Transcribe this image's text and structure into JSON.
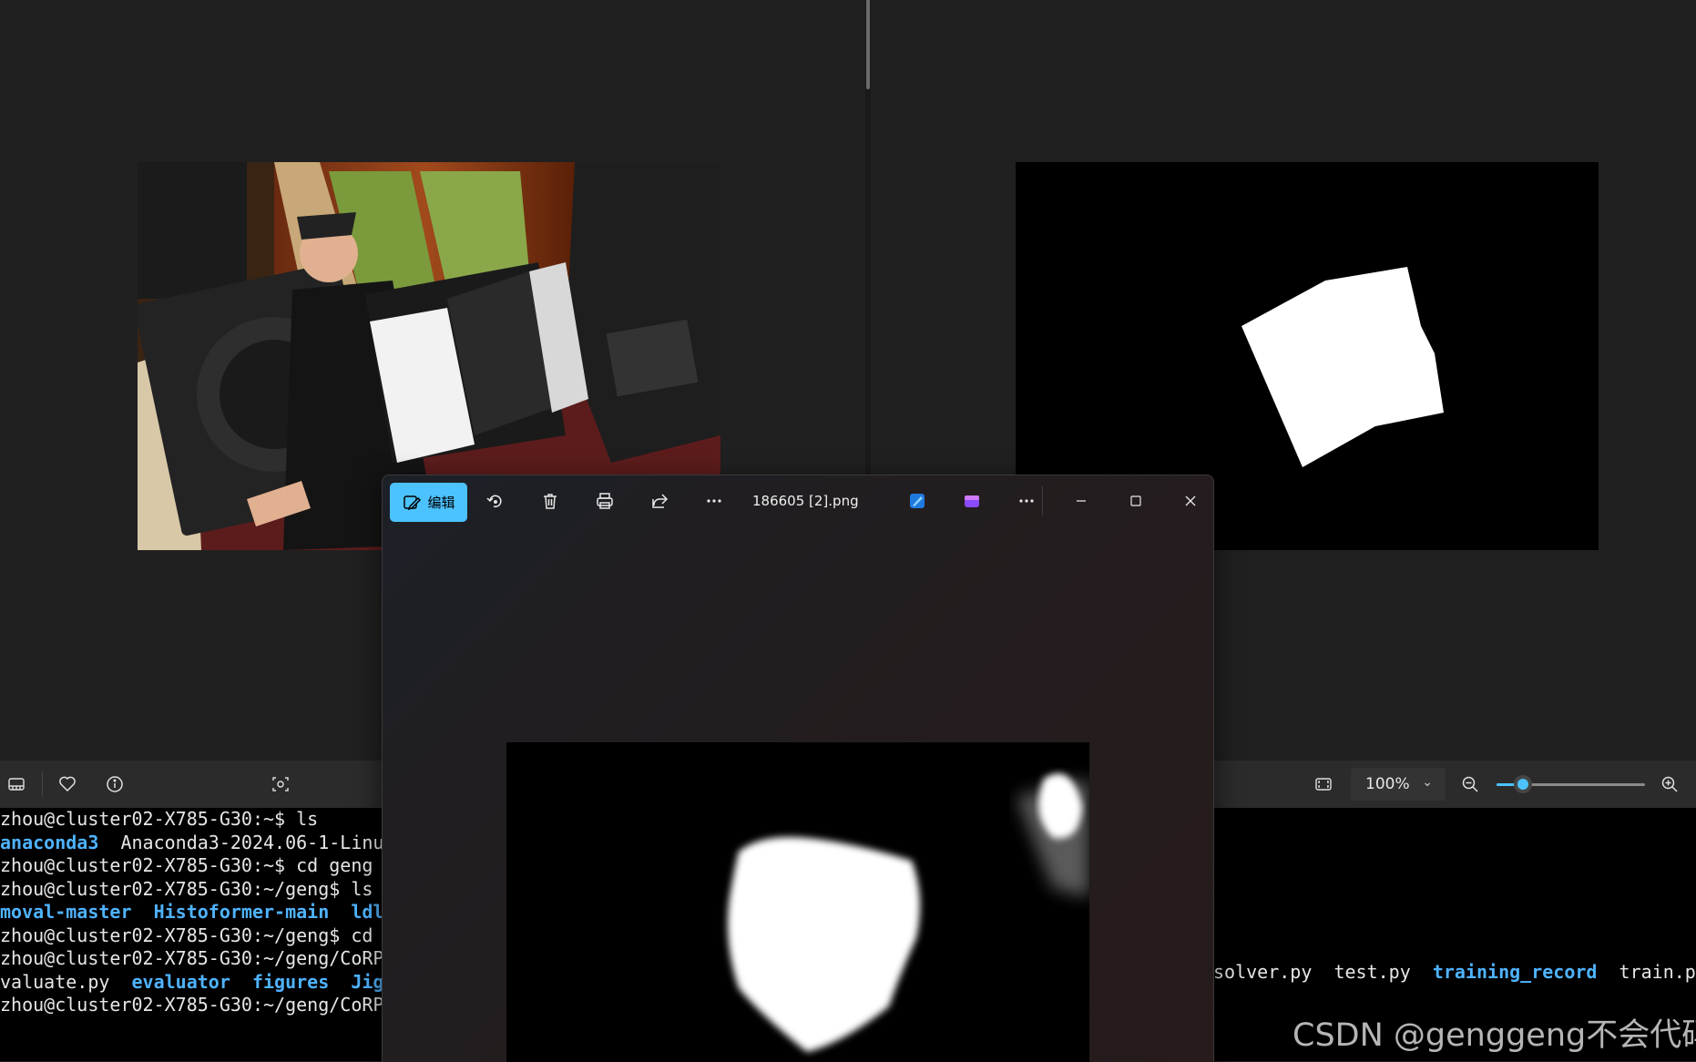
{
  "left_viewer": {
    "photo": "accordion-player-photo",
    "toolbar": {
      "icons": [
        "filmstrip-icon",
        "heart-icon",
        "info-icon",
        "face-scan-icon"
      ]
    }
  },
  "right_viewer": {
    "photo": "binary-mask-image",
    "toolbar": {
      "icons": [
        "fit-to-window-icon",
        "zoom-out-icon",
        "zoom-in-icon"
      ],
      "zoom_label": "100%",
      "zoom_level": 0.18
    }
  },
  "photos_window": {
    "edit_label": "编辑",
    "file_name": "186605 [2].png",
    "toolbar_icons": [
      "edit-icon",
      "rotate-icon",
      "delete-icon",
      "print-icon",
      "share-icon",
      "more-icon",
      "designer-icon",
      "clipchamp-icon",
      "more-icon"
    ],
    "window_controls": [
      "minimize-icon",
      "maximize-icon",
      "close-icon"
    ],
    "accent_color": "#4cc2ff"
  },
  "terminal": {
    "lines": [
      {
        "parts": [
          {
            "text": "zhou@cluster02-X785-G30:~$ ls",
            "dir": false
          }
        ]
      },
      {
        "parts": [
          {
            "text": "anaconda3",
            "dir": true
          },
          {
            "text": "  Anaconda3-2024.06-1-Linu",
            "dir": false
          }
        ]
      },
      {
        "parts": [
          {
            "text": "zhou@cluster02-X785-G30:~$ cd geng",
            "dir": false
          }
        ]
      },
      {
        "parts": [
          {
            "text": "zhou@cluster02-X785-G30:~/geng$ ls",
            "dir": false
          }
        ]
      },
      {
        "parts": [
          {
            "text": "moval-master  Histoformer-main  ldl",
            "dir": true
          }
        ]
      },
      {
        "parts": [
          {
            "text": "zhou@cluster02-X785-G30:~/geng$ cd",
            "dir": false
          }
        ]
      },
      {
        "parts": [
          {
            "text": "zhou@cluster02-X785-G30:~/geng/CoRP",
            "dir": false
          }
        ]
      },
      {
        "parts": [
          {
            "text": "valuate.py  ",
            "dir": false
          },
          {
            "text": "evaluator  figures  Jig",
            "dir": true
          }
        ]
      },
      {
        "parts": [
          {
            "text": "zhou@cluster02-X785-G30:~/geng/CoRP",
            "dir": false
          }
        ]
      }
    ],
    "right_line": [
      {
        "text": "solver.py  test.py  ",
        "dir": false
      },
      {
        "text": "training_record",
        "dir": true
      },
      {
        "text": "  train.p",
        "dir": false
      }
    ],
    "dir_color": "#4fb3ff"
  },
  "watermark": "CSDN @genggeng不会代码"
}
